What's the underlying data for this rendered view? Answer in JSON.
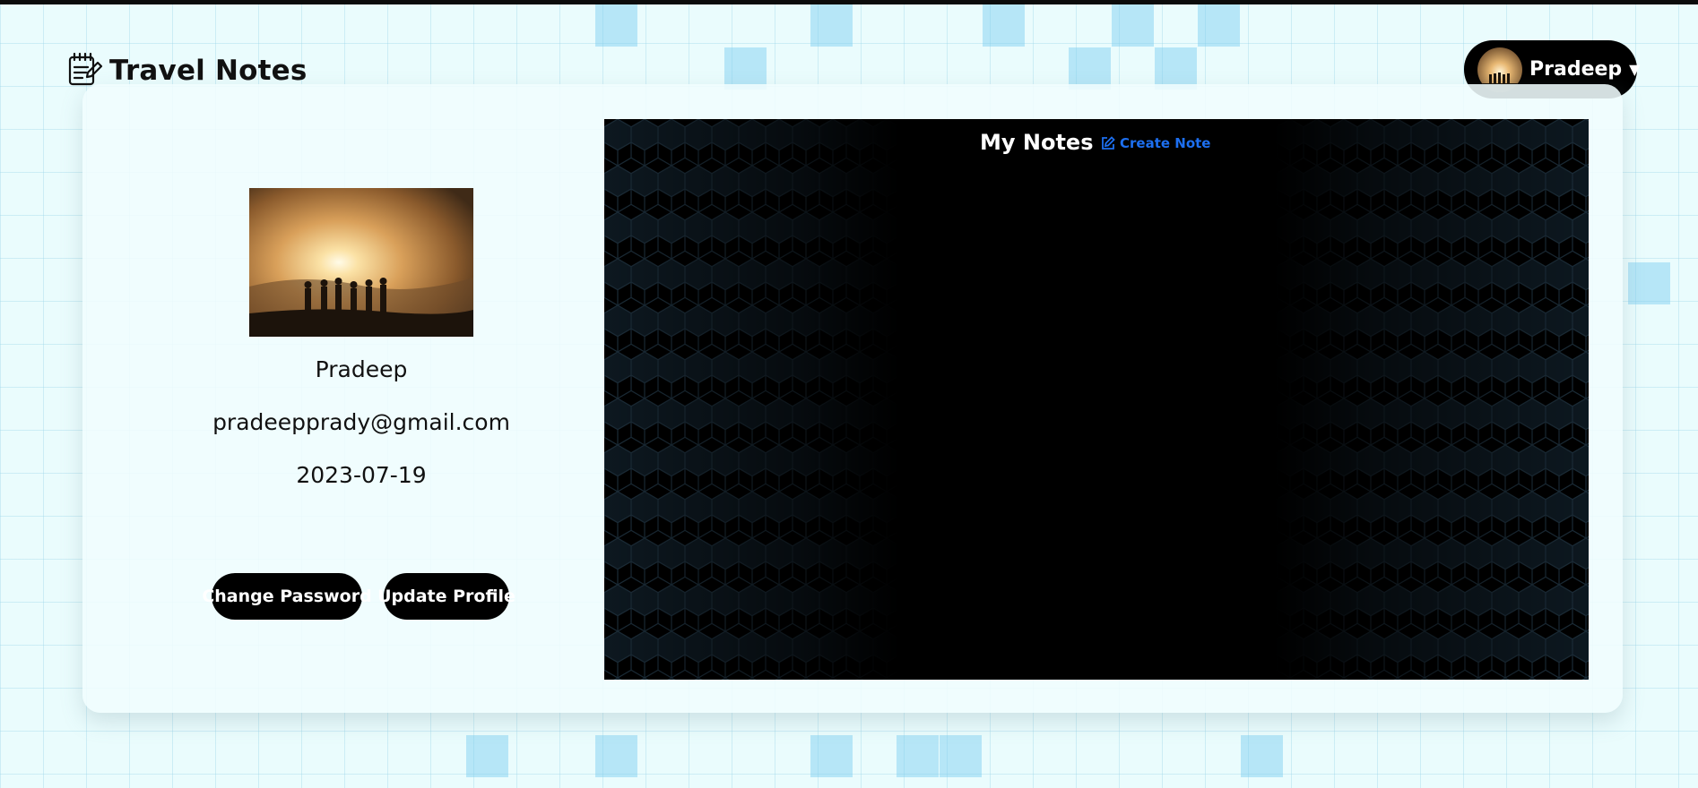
{
  "brand": {
    "title": "Travel Notes",
    "icon": "notes-icon"
  },
  "user_menu": {
    "name": "Pradeep",
    "icon": "caret-down-icon"
  },
  "profile": {
    "name": "Pradeep",
    "email": "pradeepprady@gmail.com",
    "date": "2023-07-19",
    "buttons": {
      "change_password": "Change Password",
      "update_profile": "Update Profile"
    }
  },
  "notes": {
    "title": "My Notes",
    "create_label": "Create Note",
    "create_icon": "edit-icon"
  },
  "colors": {
    "accent": "#1d6ff0",
    "dark": "#000000",
    "background": "#eafcfd"
  }
}
